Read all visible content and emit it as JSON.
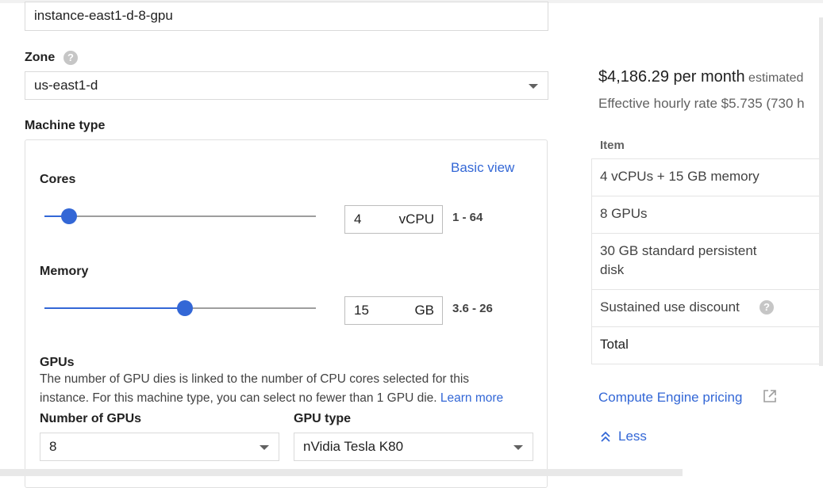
{
  "form": {
    "instance_name_value": "instance-east1-d-8-gpu",
    "zone_label": "Zone",
    "zone_value": "us-east1-d",
    "machine_type_label": "Machine type",
    "basic_view_link": "Basic view",
    "cores": {
      "label": "Cores",
      "value": "4",
      "unit": "vCPU",
      "range": "1 - 64",
      "slider_fraction": 0.0
    },
    "memory": {
      "label": "Memory",
      "value": "15",
      "unit": "GB",
      "range": "3.6 - 26",
      "slider_fraction": 0.5
    },
    "gpus": {
      "label": "GPUs",
      "description_line1": "The number of GPU dies is linked to the number of CPU cores selected for this",
      "description_line2": "instance. For this machine type, you can select no fewer than 1 GPU die.",
      "learn_more_link": "Learn more",
      "number_label": "Number of GPUs",
      "number_value": "8",
      "type_label": "GPU type",
      "type_value": "nVidia Tesla K80"
    }
  },
  "pricing": {
    "price": "$4,186.29 per month",
    "estimated": "estimated",
    "hourly": "Effective hourly rate $5.735 (730 h",
    "table_header": "Item",
    "items": [
      "4 vCPUs + 15 GB memory",
      "8 GPUs",
      "30 GB standard persistent",
      "disk",
      "Sustained use discount",
      "Total"
    ],
    "compute_link": "Compute Engine pricing",
    "less_link": "Less"
  },
  "colors": {
    "accent": "#3367d6",
    "border": "#dadada",
    "help_icon": "#c6c6c6"
  },
  "icons": [
    "help-icon",
    "dropdown-caret-icon",
    "external-link-icon",
    "chevron-up-double-icon"
  ]
}
